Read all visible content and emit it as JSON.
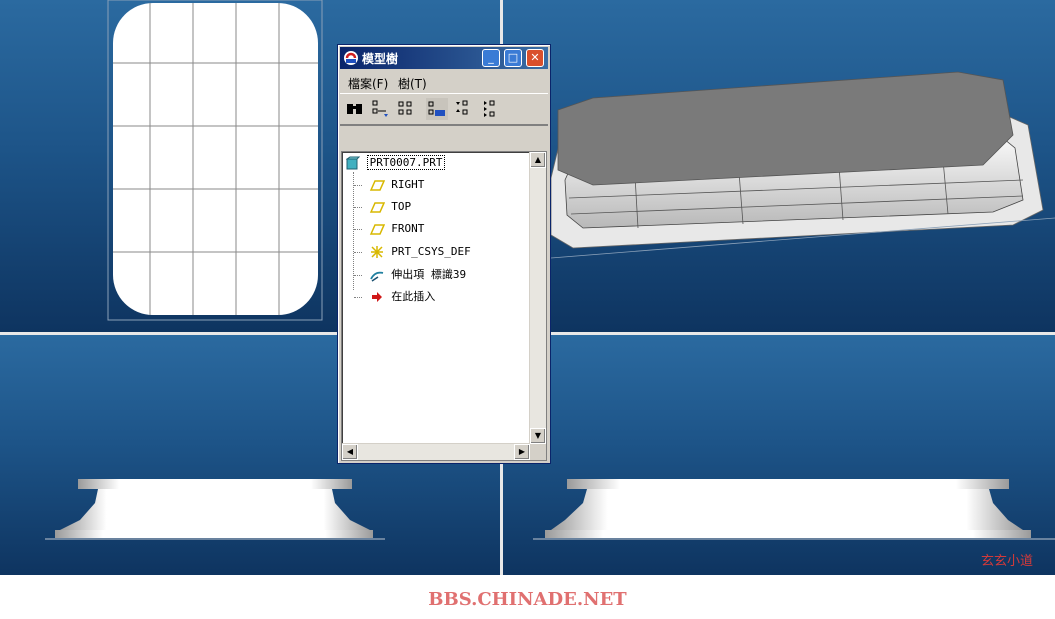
{
  "window": {
    "title": "模型樹",
    "min_label": "_",
    "max_label": "□",
    "close_label": "✕"
  },
  "menu": {
    "file": "檔案(F)",
    "tree": "樹(T)"
  },
  "toolbar": {
    "icons": [
      "find-icon",
      "show-icon",
      "settings-icon",
      "columns-icon",
      "expand-icon",
      "collapse-icon"
    ]
  },
  "tree": {
    "root": "PRT0007.PRT",
    "items": [
      {
        "label": "RIGHT",
        "icon": "datum-plane-icon"
      },
      {
        "label": "TOP",
        "icon": "datum-plane-icon"
      },
      {
        "label": "FRONT",
        "icon": "datum-plane-icon"
      },
      {
        "label": "PRT_CSYS_DEF",
        "icon": "coordinate-system-icon"
      },
      {
        "label": "伸出項 標識39",
        "icon": "protrusion-icon"
      },
      {
        "label": "在此插入",
        "icon": "insert-here-arrow-icon"
      }
    ]
  },
  "watermark": "玄玄小道",
  "site": "BBS.CHINADE.NET",
  "colors": {
    "titlebar_start": "#0a246a",
    "titlebar_end": "#3a6ea5",
    "viewport_top": "#2b6aa0",
    "viewport_bottom": "#0e3460",
    "datum_plane": "#d8b800",
    "watermark": "#d23a3a"
  }
}
